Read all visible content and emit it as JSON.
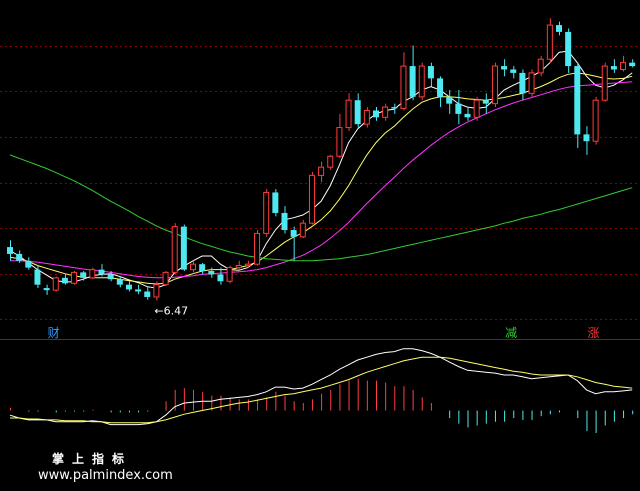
{
  "chart_data": {
    "type": "candlestick",
    "colors": {
      "up": "#ff3b3b",
      "down": "#4fe8f0",
      "ma5": "#ffffff",
      "ma10": "#ffff66",
      "ma20": "#ff33ff",
      "ma60": "#33cc33",
      "grid": "#8a0000",
      "dif": "#ffffff",
      "dea": "#ffff66"
    },
    "ohlc": [
      [
        7.25,
        7.35,
        7.15,
        7.05
      ],
      [
        7.15,
        7.2,
        7.05,
        7.02
      ],
      [
        7.05,
        7.1,
        6.95,
        6.92
      ],
      [
        6.92,
        6.98,
        6.7,
        6.65
      ],
      [
        6.65,
        6.7,
        6.62,
        6.55
      ],
      [
        6.62,
        6.82,
        6.8,
        6.6
      ],
      [
        6.8,
        6.85,
        6.72,
        6.7
      ],
      [
        6.72,
        6.9,
        6.88,
        6.7
      ],
      [
        6.88,
        6.9,
        6.8,
        6.76
      ],
      [
        6.8,
        6.95,
        6.92,
        6.78
      ],
      [
        6.92,
        7.0,
        6.85,
        6.82
      ],
      [
        6.85,
        6.9,
        6.78,
        6.75
      ],
      [
        6.78,
        6.82,
        6.7,
        6.66
      ],
      [
        6.7,
        6.75,
        6.63,
        6.6
      ],
      [
        6.63,
        6.7,
        6.6,
        6.56
      ],
      [
        6.6,
        6.68,
        6.52,
        6.48
      ],
      [
        6.52,
        6.75,
        6.7,
        6.47
      ],
      [
        6.7,
        6.9,
        6.88,
        6.68
      ],
      [
        6.88,
        7.6,
        7.55,
        6.85
      ],
      [
        7.55,
        7.58,
        6.92,
        6.9
      ],
      [
        6.92,
        7.05,
        7.0,
        6.88
      ],
      [
        7.0,
        7.02,
        6.9,
        6.85
      ],
      [
        6.9,
        6.95,
        6.85,
        6.8
      ],
      [
        6.85,
        6.95,
        6.75,
        6.7
      ],
      [
        6.75,
        6.98,
        6.95,
        6.72
      ],
      [
        6.95,
        7.05,
        6.98,
        6.92
      ],
      [
        6.98,
        7.05,
        7.0,
        6.95
      ],
      [
        7.0,
        7.5,
        7.45,
        6.98
      ],
      [
        7.45,
        8.1,
        8.05,
        7.4
      ],
      [
        8.05,
        8.1,
        7.75,
        7.7
      ],
      [
        7.75,
        7.85,
        7.5,
        7.45
      ],
      [
        7.5,
        7.55,
        7.4,
        7.05
      ],
      [
        7.4,
        7.65,
        7.6,
        7.38
      ],
      [
        7.6,
        8.35,
        8.3,
        7.58
      ],
      [
        8.3,
        8.5,
        8.42,
        8.2
      ],
      [
        8.42,
        8.6,
        8.58,
        8.38
      ],
      [
        8.58,
        9.2,
        9.0,
        8.55
      ],
      [
        9.0,
        9.5,
        9.4,
        8.95
      ],
      [
        9.4,
        9.5,
        9.05,
        9.0
      ],
      [
        9.05,
        9.3,
        9.25,
        9.0
      ],
      [
        9.25,
        9.3,
        9.15,
        9.1
      ],
      [
        9.15,
        9.35,
        9.3,
        9.1
      ],
      [
        9.3,
        9.35,
        9.28,
        9.2
      ],
      [
        9.28,
        10.1,
        9.9,
        9.25
      ],
      [
        9.9,
        10.2,
        9.45,
        9.4
      ],
      [
        9.45,
        9.95,
        9.9,
        9.4
      ],
      [
        9.9,
        9.95,
        9.72,
        9.6
      ],
      [
        9.72,
        9.75,
        9.45,
        9.3
      ],
      [
        9.45,
        9.55,
        9.35,
        9.2
      ],
      [
        9.35,
        9.55,
        9.2,
        9.05
      ],
      [
        9.2,
        9.3,
        9.15,
        9.1
      ],
      [
        9.15,
        9.45,
        9.4,
        9.1
      ],
      [
        9.4,
        9.5,
        9.35,
        9.2
      ],
      [
        9.35,
        9.95,
        9.9,
        9.3
      ],
      [
        9.9,
        10.0,
        9.85,
        9.75
      ],
      [
        9.85,
        9.9,
        9.8,
        9.72
      ],
      [
        9.8,
        9.85,
        9.5,
        9.4
      ],
      [
        9.5,
        9.85,
        9.8,
        9.45
      ],
      [
        9.8,
        10.05,
        10.0,
        9.75
      ],
      [
        10.0,
        10.6,
        10.5,
        9.95
      ],
      [
        10.5,
        10.55,
        10.4,
        10.35
      ],
      [
        10.4,
        10.45,
        9.9,
        9.8
      ],
      [
        9.9,
        9.95,
        8.9,
        8.7
      ],
      [
        8.9,
        9.02,
        8.8,
        8.6
      ],
      [
        8.8,
        9.45,
        9.4,
        8.75
      ],
      [
        9.4,
        9.95,
        9.9,
        9.38
      ],
      [
        9.9,
        10.0,
        9.85,
        9.8
      ],
      [
        9.85,
        10.05,
        9.95,
        9.82
      ],
      [
        9.95,
        10.0,
        9.9,
        9.88
      ]
    ],
    "ma_series": [
      {
        "name": "MA5",
        "color": "#ffffff",
        "values": [
          7.2,
          7.12,
          7.02,
          6.92,
          6.84,
          6.76,
          6.74,
          6.74,
          6.78,
          6.83,
          6.85,
          6.86,
          6.82,
          6.77,
          6.73,
          6.67,
          6.65,
          6.7,
          6.88,
          6.97,
          7.05,
          7.12,
          7.12,
          7.0,
          6.92,
          6.91,
          6.95,
          7.05,
          7.3,
          7.5,
          7.65,
          7.68,
          7.72,
          7.8,
          7.92,
          8.15,
          8.45,
          8.78,
          8.98,
          9.1,
          9.2,
          9.25,
          9.27,
          9.38,
          9.45,
          9.55,
          9.6,
          9.55,
          9.45,
          9.35,
          9.3,
          9.28,
          9.3,
          9.42,
          9.55,
          9.62,
          9.68,
          9.75,
          9.82,
          9.95,
          10.1,
          10.12,
          9.95,
          9.75,
          9.62,
          9.58,
          9.62,
          9.7,
          9.8
        ]
      },
      {
        "name": "MA10",
        "color": "#ffff66",
        "values": [
          7.1,
          7.08,
          7.04,
          6.98,
          6.94,
          6.9,
          6.86,
          6.83,
          6.81,
          6.8,
          6.8,
          6.8,
          6.78,
          6.76,
          6.74,
          6.72,
          6.71,
          6.72,
          6.78,
          6.82,
          6.86,
          6.9,
          6.92,
          6.92,
          6.92,
          6.95,
          6.98,
          7.03,
          7.12,
          7.22,
          7.32,
          7.4,
          7.46,
          7.55,
          7.65,
          7.78,
          7.95,
          8.15,
          8.38,
          8.6,
          8.78,
          8.92,
          9.02,
          9.15,
          9.27,
          9.37,
          9.42,
          9.45,
          9.45,
          9.44,
          9.42,
          9.41,
          9.4,
          9.42,
          9.44,
          9.47,
          9.5,
          9.55,
          9.6,
          9.66,
          9.73,
          9.78,
          9.8,
          9.78,
          9.75,
          9.72,
          9.71,
          9.72,
          9.75
        ]
      },
      {
        "name": "MA20",
        "color": "#ff33ff",
        "values": [
          7.05,
          7.05,
          7.04,
          7.03,
          7.01,
          6.99,
          6.97,
          6.95,
          6.93,
          6.91,
          6.9,
          6.88,
          6.86,
          6.84,
          6.82,
          6.81,
          6.8,
          6.8,
          6.81,
          6.82,
          6.83,
          6.85,
          6.86,
          6.87,
          6.88,
          6.89,
          6.9,
          6.92,
          6.95,
          6.99,
          7.03,
          7.08,
          7.13,
          7.2,
          7.28,
          7.38,
          7.49,
          7.61,
          7.75,
          7.89,
          8.02,
          8.15,
          8.27,
          8.4,
          8.52,
          8.63,
          8.74,
          8.84,
          8.93,
          9.01,
          9.08,
          9.14,
          9.2,
          9.26,
          9.31,
          9.36,
          9.4,
          9.44,
          9.48,
          9.52,
          9.56,
          9.59,
          9.61,
          9.62,
          9.63,
          9.64,
          9.65,
          9.66,
          9.67
        ]
      },
      {
        "name": "MA60",
        "color": "#33cc33",
        "values": [
          8.6,
          8.55,
          8.5,
          8.45,
          8.4,
          8.34,
          8.28,
          8.22,
          8.15,
          8.08,
          8.0,
          7.92,
          7.85,
          7.78,
          7.7,
          7.63,
          7.56,
          7.5,
          7.45,
          7.4,
          7.35,
          7.3,
          7.26,
          7.22,
          7.18,
          7.15,
          7.12,
          7.1,
          7.08,
          7.07,
          7.06,
          7.05,
          7.05,
          7.05,
          7.06,
          7.07,
          7.08,
          7.1,
          7.12,
          7.14,
          7.17,
          7.2,
          7.23,
          7.26,
          7.29,
          7.32,
          7.35,
          7.38,
          7.41,
          7.44,
          7.47,
          7.5,
          7.53,
          7.56,
          7.6,
          7.63,
          7.67,
          7.7,
          7.73,
          7.77,
          7.8,
          7.84,
          7.88,
          7.92,
          7.96,
          8.0,
          8.04,
          8.08,
          8.12
        ]
      }
    ],
    "annotations": [
      {
        "text": "←6.47",
        "index": 16,
        "price": 6.47,
        "color": "#ffffff"
      }
    ],
    "signals": [
      {
        "text": "财",
        "index": 4,
        "color": "#3399ff"
      },
      {
        "text": "减",
        "index": 54,
        "color": "#33cc33"
      },
      {
        "text": "涨",
        "index": 63,
        "color": "#ff3333"
      }
    ],
    "price_range": [
      6.3,
      10.75
    ],
    "macd": {
      "range": [
        -0.4,
        0.7
      ],
      "dif": [
        -0.05,
        -0.08,
        -0.1,
        -0.1,
        -0.1,
        -0.12,
        -0.12,
        -0.12,
        -0.12,
        -0.11,
        -0.12,
        -0.15,
        -0.15,
        -0.15,
        -0.15,
        -0.14,
        -0.12,
        -0.05,
        0.04,
        0.08,
        0.09,
        0.1,
        0.1,
        0.12,
        0.13,
        0.14,
        0.15,
        0.17,
        0.2,
        0.25,
        0.25,
        0.23,
        0.24,
        0.28,
        0.33,
        0.38,
        0.44,
        0.49,
        0.54,
        0.57,
        0.6,
        0.62,
        0.63,
        0.66,
        0.66,
        0.64,
        0.61,
        0.57,
        0.52,
        0.47,
        0.43,
        0.42,
        0.41,
        0.4,
        0.38,
        0.38,
        0.36,
        0.34,
        0.35,
        0.36,
        0.37,
        0.38,
        0.32,
        0.22,
        0.18,
        0.2,
        0.2,
        0.21,
        0.22
      ],
      "dea": [
        -0.08,
        -0.08,
        -0.09,
        -0.09,
        -0.1,
        -0.1,
        -0.11,
        -0.11,
        -0.11,
        -0.12,
        -0.12,
        -0.13,
        -0.13,
        -0.13,
        -0.13,
        -0.13,
        -0.12,
        -0.1,
        -0.07,
        -0.04,
        -0.02,
        0.0,
        0.02,
        0.04,
        0.06,
        0.08,
        0.09,
        0.11,
        0.13,
        0.15,
        0.17,
        0.18,
        0.2,
        0.22,
        0.24,
        0.27,
        0.3,
        0.33,
        0.37,
        0.41,
        0.44,
        0.47,
        0.5,
        0.53,
        0.55,
        0.57,
        0.57,
        0.57,
        0.56,
        0.54,
        0.52,
        0.5,
        0.48,
        0.46,
        0.44,
        0.42,
        0.41,
        0.39,
        0.38,
        0.38,
        0.38,
        0.38,
        0.36,
        0.33,
        0.3,
        0.28,
        0.26,
        0.25,
        0.24
      ],
      "hist": [
        0.03,
        0.0,
        -0.01,
        -0.01,
        0.0,
        -0.02,
        -0.01,
        -0.01,
        -0.01,
        0.01,
        0.0,
        -0.02,
        -0.02,
        -0.02,
        -0.02,
        -0.01,
        0.0,
        0.1,
        0.22,
        0.24,
        0.22,
        0.2,
        0.16,
        0.16,
        0.14,
        0.12,
        0.12,
        0.12,
        0.14,
        0.2,
        0.16,
        0.1,
        0.08,
        0.12,
        0.18,
        0.22,
        0.28,
        0.32,
        0.34,
        0.32,
        0.32,
        0.3,
        0.26,
        0.26,
        0.22,
        0.14,
        0.08,
        0.0,
        -0.08,
        -0.14,
        -0.18,
        -0.16,
        -0.14,
        -0.12,
        -0.12,
        -0.08,
        -0.1,
        -0.1,
        -0.06,
        -0.04,
        -0.02,
        0.0,
        -0.08,
        -0.22,
        -0.24,
        -0.16,
        -0.12,
        -0.08,
        -0.04
      ]
    }
  },
  "watermark": {
    "cn_text": "掌上指标",
    "url": "www.palmindex.com"
  }
}
